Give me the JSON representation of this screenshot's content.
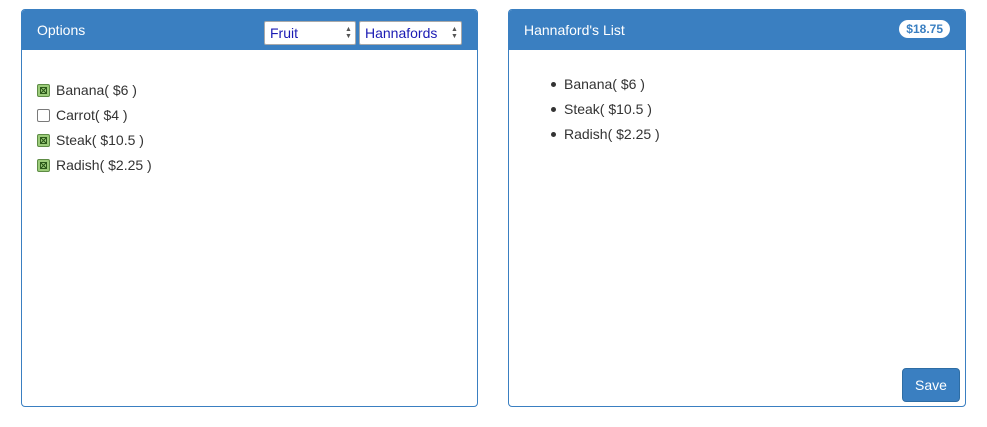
{
  "options_panel": {
    "title": "Options",
    "category_select": {
      "value": "Fruit"
    },
    "store_select": {
      "value": "Hannafords"
    },
    "items": [
      {
        "label": "Banana( $6 )",
        "checked": true
      },
      {
        "label": "Carrot( $4 )",
        "checked": false
      },
      {
        "label": "Steak( $10.5 )",
        "checked": true
      },
      {
        "label": "Radish( $2.25 )",
        "checked": true
      }
    ]
  },
  "list_panel": {
    "title": "Hannaford's List",
    "total_badge": "$18.75",
    "items": [
      {
        "label": "Banana( $6 )"
      },
      {
        "label": "Steak( $10.5 )"
      },
      {
        "label": "Radish( $2.25 )"
      }
    ],
    "save_label": "Save"
  },
  "colors": {
    "primary": "#3a7fc1",
    "select_text": "#1a1ab3",
    "checkbox_checked": "#9ccc7a"
  }
}
